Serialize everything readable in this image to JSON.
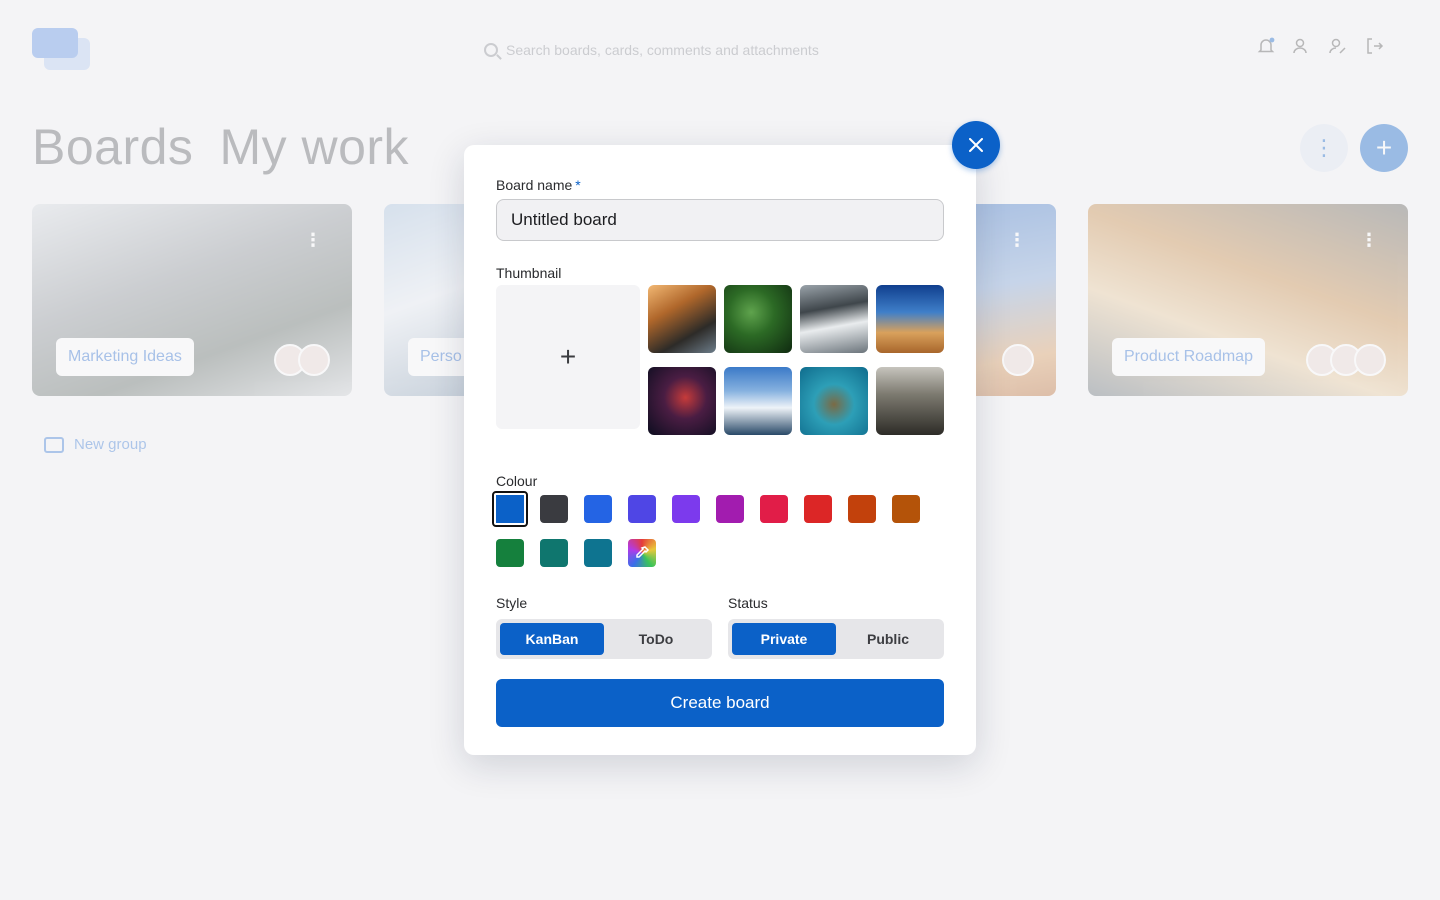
{
  "header": {
    "search_placeholder": "Search boards, cards, comments and attachments"
  },
  "page": {
    "title_boards": "Boards",
    "title_mywork": "My work"
  },
  "boards": [
    {
      "label": "Marketing Ideas"
    },
    {
      "label": "Perso"
    },
    {
      "label": ""
    },
    {
      "label": "Product Roadmap"
    }
  ],
  "new_group_label": "New group",
  "modal": {
    "board_name_label": "Board name",
    "required_mark": "*",
    "board_name_value": "Untitled board",
    "thumbnail_label": "Thumbnail",
    "upload_symbol": "+",
    "thumbnails": [
      "sea-cliffs",
      "green-leaf",
      "mountain-clouds",
      "desert-dunes",
      "galaxy",
      "snowy-mountain",
      "sea-turtle",
      "misty-forest"
    ],
    "colour_label": "Colour",
    "colours": [
      {
        "name": "blue",
        "hex": "#0b61c8",
        "selected": true
      },
      {
        "name": "charcoal",
        "hex": "#3a3b40",
        "selected": false
      },
      {
        "name": "royal-blue",
        "hex": "#2464e4",
        "selected": false
      },
      {
        "name": "indigo",
        "hex": "#4f46e5",
        "selected": false
      },
      {
        "name": "violet",
        "hex": "#7c3aed",
        "selected": false
      },
      {
        "name": "purple",
        "hex": "#a21caf",
        "selected": false
      },
      {
        "name": "rose",
        "hex": "#e11d48",
        "selected": false
      },
      {
        "name": "red",
        "hex": "#dc2626",
        "selected": false
      },
      {
        "name": "orange",
        "hex": "#c2410c",
        "selected": false
      },
      {
        "name": "amber",
        "hex": "#b45309",
        "selected": false
      },
      {
        "name": "green",
        "hex": "#15803d",
        "selected": false
      },
      {
        "name": "teal",
        "hex": "#0f766e",
        "selected": false
      },
      {
        "name": "cyan",
        "hex": "#0e7490",
        "selected": false
      }
    ],
    "style_label": "Style",
    "style_options": [
      "KanBan",
      "ToDo"
    ],
    "style_selected": "KanBan",
    "status_label": "Status",
    "status_options": [
      "Private",
      "Public"
    ],
    "status_selected": "Private",
    "create_button": "Create board"
  },
  "icons": {
    "close": "close-icon",
    "picker": "eyedropper-icon"
  }
}
